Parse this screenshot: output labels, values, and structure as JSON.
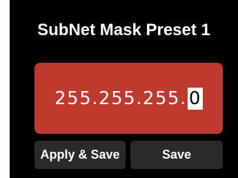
{
  "title": "SubNet Mask Preset 1",
  "ip": {
    "prefix": "255.255.255.",
    "cursor_digit": "0"
  },
  "buttons": {
    "apply_save_label": "Apply & Save",
    "save_label": "Save"
  },
  "colors": {
    "background": "#000000",
    "field": "#c0392f",
    "button": "#2a2a2a",
    "text": "#ffffff"
  }
}
